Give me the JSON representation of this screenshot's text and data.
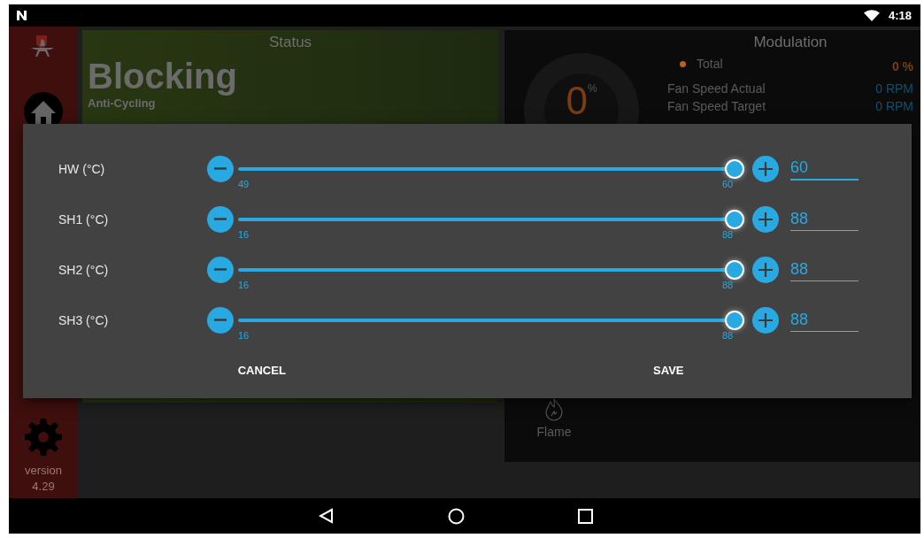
{
  "status_bar": {
    "time": "4:18"
  },
  "sidebar": {
    "version_label": "version",
    "version": "4.29"
  },
  "status_card": {
    "title": "Status",
    "state": "Blocking",
    "substate": "Anti-Cycling"
  },
  "modulation_card": {
    "title": "Modulation",
    "gauge_value": "0",
    "gauge_unit": "%",
    "legend": [
      {
        "label": "Total",
        "value": "0 %",
        "color": "#b8621e"
      }
    ],
    "readings": [
      {
        "label": "Fan Speed Actual",
        "value": "0 RPM"
      },
      {
        "label": "Fan Speed Target",
        "value": "0 RPM"
      }
    ],
    "flame_label": "Flame"
  },
  "dialog": {
    "rows": [
      {
        "label": "HW (°C)",
        "min": "49",
        "max": "60",
        "level": 1,
        "value": "60",
        "focused": true
      },
      {
        "label": "SH1 (°C)",
        "min": "16",
        "max": "88",
        "level": 1,
        "value": "88",
        "focused": false
      },
      {
        "label": "SH2 (°C)",
        "min": "16",
        "max": "88",
        "level": 1,
        "value": "88",
        "focused": false
      },
      {
        "label": "SH3 (°C)",
        "min": "16",
        "max": "88",
        "level": 1,
        "value": "88",
        "focused": false
      }
    ],
    "buttons": [
      "CANCEL",
      "SAVE"
    ]
  }
}
